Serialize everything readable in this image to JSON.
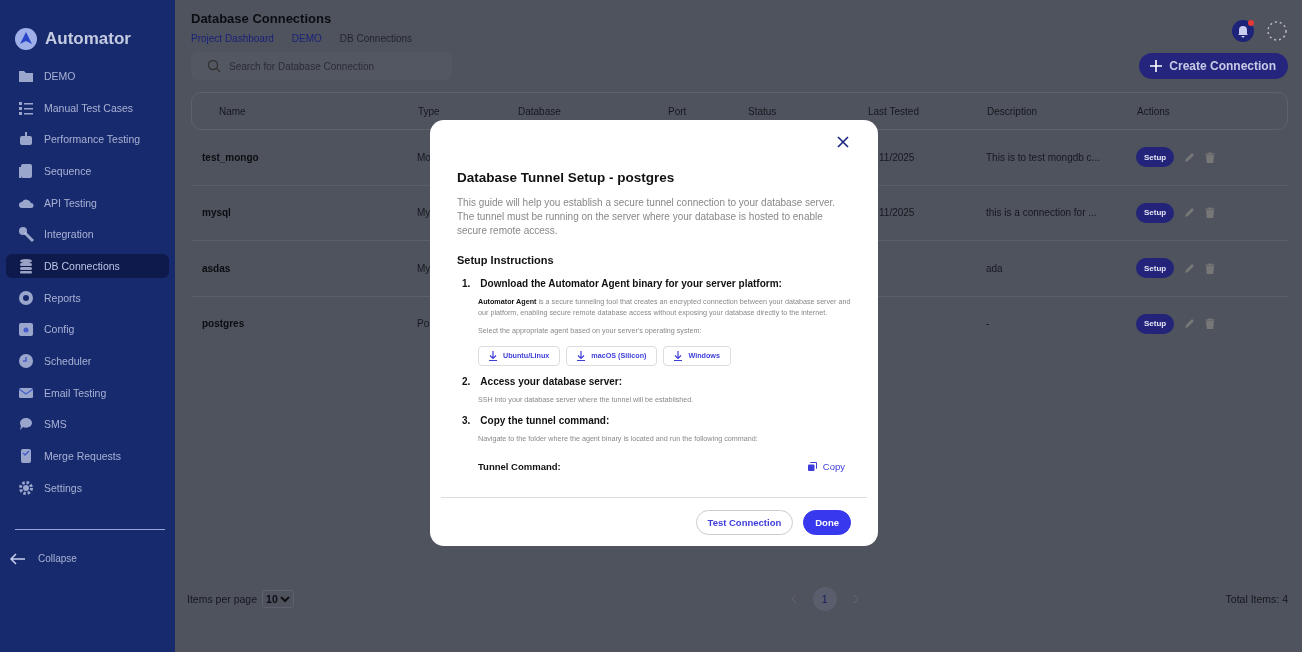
{
  "sidebar": {
    "brand": "Automator",
    "items": [
      {
        "label": "DEMO",
        "selected": false
      },
      {
        "label": "Manual Test Cases",
        "selected": false
      },
      {
        "label": "Performance Testing",
        "selected": false
      },
      {
        "label": "Sequence",
        "selected": false
      },
      {
        "label": "API Testing",
        "selected": false
      },
      {
        "label": "Integration",
        "selected": false
      },
      {
        "label": "DB Connections",
        "selected": true
      },
      {
        "label": "Reports",
        "selected": false
      },
      {
        "label": "Config",
        "selected": false
      },
      {
        "label": "Scheduler",
        "selected": false
      },
      {
        "label": "Email Testing",
        "selected": false
      },
      {
        "label": "SMS",
        "selected": false
      },
      {
        "label": "Merge Requests",
        "selected": false
      },
      {
        "label": "Settings",
        "selected": false
      }
    ],
    "collapse": "Collapse"
  },
  "header": {
    "title": "Database Connections",
    "breadcrumb": [
      "Project Dashboard",
      "DEMO",
      "DB Connections"
    ],
    "notification": true
  },
  "search": {
    "placeholder": "Search for Database Connection"
  },
  "create_button": "Create Connection",
  "table": {
    "columns": [
      "Name",
      "Type",
      "Database",
      "Port",
      "Status",
      "Last Tested",
      "Description",
      "Actions"
    ],
    "rows": [
      {
        "name": "test_mongo",
        "type": "Mo",
        "last_tested": "11/2025",
        "description": "This is to test mongdb c...",
        "action": "Setup"
      },
      {
        "name": "mysql",
        "type": "My",
        "last_tested": "11/2025",
        "description": "this is a connection for ...",
        "action": "Setup"
      },
      {
        "name": "asdas",
        "type": "My",
        "description": "ada",
        "action": "Setup"
      },
      {
        "name": "postgres",
        "type": "Po",
        "description": "-",
        "action": "Setup"
      }
    ]
  },
  "footer": {
    "items_per_page_label": "Items per page",
    "items_per_page": "10",
    "pages": [
      {
        "label": "1",
        "selected": true
      }
    ],
    "total": "Total Items: 4"
  },
  "modal": {
    "title": "Database Tunnel Setup - postgres",
    "intro": "This guide will help you establish a secure tunnel connection to your database server. The tunnel must be running on the server where your database is hosted to enable secure remote access.",
    "section": "Setup Instructions",
    "steps": [
      {
        "number": "1.",
        "title": "Download the Automator Agent binary for your server platform:",
        "texts": [
          "**Automator Agent** is a secure tunneling tool that creates an encrypted connection between your database server and our platform, enabling secure remote database access without exposing your database directly to the internet.",
          "Select the appropriate agent based on your server's operating system:"
        ],
        "downloads": [
          "Ubuntu/Linux",
          "macOS (Silicon)",
          "Windows"
        ]
      },
      {
        "number": "2.",
        "title": "Access your database server:",
        "texts": [
          "SSH into your database server where the tunnel will be established."
        ]
      },
      {
        "number": "3.",
        "title": "Copy the tunnel command:",
        "texts": [
          "Navigate to the folder where the agent binary is located and run the following command:"
        ]
      }
    ],
    "command_label": "Tunnel Command:",
    "copy": "Copy",
    "buttons": [
      "Test Connection",
      "Done"
    ]
  }
}
